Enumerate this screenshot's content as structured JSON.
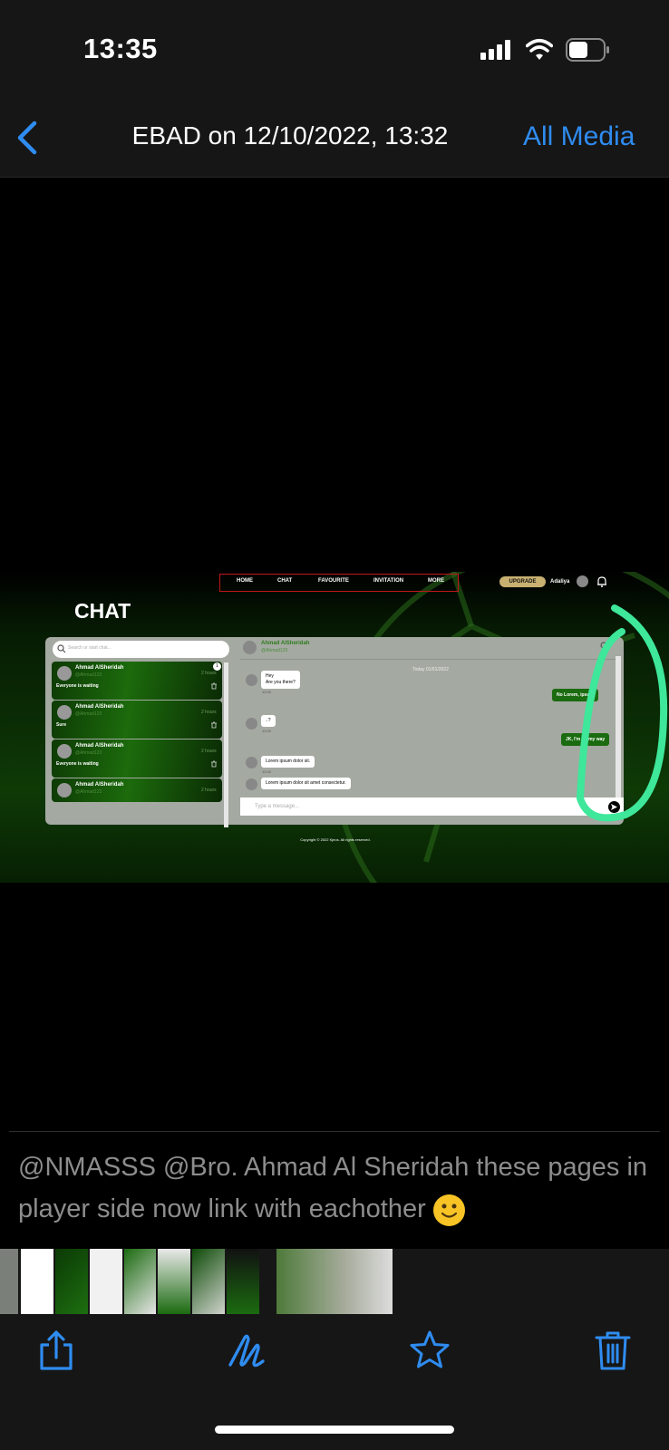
{
  "status_bar": {
    "time": "13:35"
  },
  "nav": {
    "back_icon": "chevron-left-icon",
    "title": "EBAD on 12/10/2022, 13:32",
    "right_action": "All Media",
    "accent_color": "#2f8cf0"
  },
  "screenshot": {
    "top_menu": [
      "HOME",
      "CHAT",
      "FAVOURITE",
      "INVITATION",
      "MORE"
    ],
    "upgrade_label": "UPGRADE",
    "user_name": "Adaliya",
    "page_title": "CHAT",
    "search_placeholder": "Search or start chat...",
    "conversations": [
      {
        "name": "Ahmad AlSheridah",
        "handle": "@Ahmad123",
        "preview": "Everyone is waiting",
        "time": "2 hours",
        "unread": "1"
      },
      {
        "name": "Ahmad AlSheridah",
        "handle": "@Ahmad123",
        "preview": "Sure",
        "time": "2 hours"
      },
      {
        "name": "Ahmad AlSheridah",
        "handle": "@Ahmad123",
        "preview": "Everyone is waiting",
        "time": "2 hours"
      },
      {
        "name": "Ahmad AlSheridah",
        "handle": "@Ahmad123",
        "preview": "",
        "time": "2 hours"
      }
    ],
    "chat_header": {
      "name": "Ahmad AlSheridah",
      "handle": "@Ahmad123"
    },
    "date_separator": "Today 01/01/2022",
    "messages": [
      {
        "dir": "in",
        "text1": "Hey",
        "text2": "Are you there?",
        "time": "12:00"
      },
      {
        "dir": "out",
        "text1": "No Lorem, ipsum",
        "time": ""
      },
      {
        "dir": "in",
        "text1": "..?",
        "time": "12:00"
      },
      {
        "dir": "out",
        "text1": "JK, I'm on my way",
        "time": ""
      },
      {
        "dir": "in",
        "text1": "Lorem ipsum dolor sit.",
        "time": "12:00"
      },
      {
        "dir": "in",
        "text1": "Lorem ipsum dolor sit amet consectetur.",
        "time": ""
      }
    ],
    "input_placeholder": "Type a message...",
    "copyright": "Copyright © 2022 Kjeos. All rights reserved.",
    "annotation_color": "#3ee79a"
  },
  "caption": "@NMASSS @Bro. Ahmad Al Sheridah these pages in player side now link with eachother",
  "toolbar": {
    "share": "share-icon",
    "markup": "markup-icon",
    "favorite": "star-icon",
    "delete": "trash-icon"
  }
}
